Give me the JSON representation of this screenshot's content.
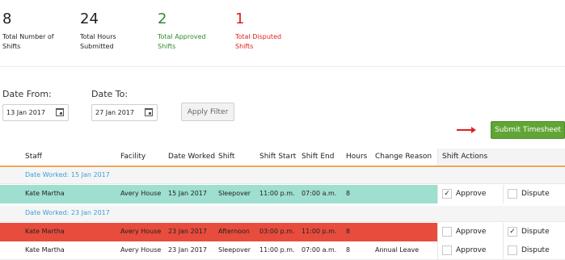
{
  "stats": [
    {
      "value": "8",
      "label_line1": "Total Number of",
      "label_line2": "Shifts",
      "color": "#222222"
    },
    {
      "value": "24",
      "label_line1": "Total Hours",
      "label_line2": "Submitted",
      "color": "#222222"
    },
    {
      "value": "2",
      "label_line1": "Total Approved",
      "label_line2": "Shifts",
      "color": "#2e8b2e"
    },
    {
      "value": "1",
      "label_line1": "Total Disputed",
      "label_line2": "Shifts",
      "color": "#e02020"
    }
  ],
  "filters": {
    "date_from_label": "Date From:",
    "date_from_value": "13 Jan 2017",
    "date_to_label": "Date To:",
    "date_to_value": "27 Jan 2017",
    "apply_label": "Apply Filter"
  },
  "submit_label": "Submit Timesheet",
  "table": {
    "headers": {
      "staff": "Staff",
      "facility": "Facility",
      "date_worked": "Date Worked",
      "shift": "Shift",
      "shift_start": "Shift Start",
      "shift_end": "Shift End",
      "hours": "Hours",
      "change_reason": "Change Reason",
      "shift_actions": "Shift Actions"
    },
    "groups": [
      {
        "label": "Date Worked: 15 Jan 2017"
      },
      {
        "label": "Date Worked: 23 Jan 2017"
      }
    ],
    "rows": [
      {
        "staff": "Kate Martha",
        "facility": "Avery House",
        "date_worked": "15 Jan 2017",
        "shift": "Sleepover",
        "start": "11:00 p.m.",
        "end": "07:00 a.m.",
        "hours": "8",
        "reason": "",
        "approve_checked": "✓",
        "dispute_checked": "",
        "status": "approved"
      },
      {
        "staff": "Kate Martha",
        "facility": "Avery House",
        "date_worked": "23 Jan 2017",
        "shift": "Afternoon",
        "start": "03:00 p.m.",
        "end": "11:00 p.m.",
        "hours": "8",
        "reason": "",
        "approve_checked": "",
        "dispute_checked": "✓",
        "status": "disputed"
      },
      {
        "staff": "Kate Martha",
        "facility": "Avery House",
        "date_worked": "23 Jan 2017",
        "shift": "Sleepover",
        "start": "11:00 p.m.",
        "end": "07:00 a.m.",
        "hours": "8",
        "reason": "Annual Leave",
        "approve_checked": "",
        "dispute_checked": "",
        "status": "none"
      }
    ],
    "approve_label": "Approve",
    "dispute_label": "Dispute"
  },
  "colors": {
    "approved_row": "#9fdfcf",
    "disputed_row": "#e84c3d",
    "submit_button": "#61a536",
    "group_text": "#3aa0d8",
    "header_underline": "#f0a35a"
  }
}
